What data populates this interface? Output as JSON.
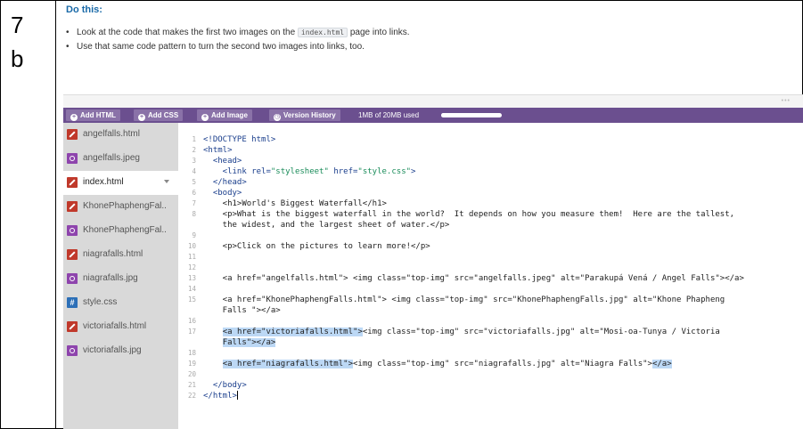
{
  "step": {
    "number": "7",
    "letter": "b"
  },
  "instructions": {
    "heading": "Do this:",
    "bullet1_before": "Look at the code that makes the first two images on the ",
    "bullet1_code": "index.html",
    "bullet1_after": " page into links.",
    "bullet2": "Use that same code pattern to turn the second two images into links, too."
  },
  "toolbar": {
    "add_html": "Add HTML",
    "add_css": "Add CSS",
    "add_image": "Add Image",
    "version_history": "Version History",
    "storage": "1MB of 20MB used",
    "storage_fraction": 0.05
  },
  "files": [
    {
      "name": "angelfalls.html",
      "type": "html"
    },
    {
      "name": "angelfalls.jpeg",
      "type": "img"
    },
    {
      "name": "index.html",
      "type": "html",
      "selected": true
    },
    {
      "name": "KhonePhaphengFal..",
      "type": "html"
    },
    {
      "name": "KhonePhaphengFal..",
      "type": "img"
    },
    {
      "name": "niagrafalls.html",
      "type": "html"
    },
    {
      "name": "niagrafalls.jpg",
      "type": "img"
    },
    {
      "name": "style.css",
      "type": "css",
      "icon_glyph": "#"
    },
    {
      "name": "victoriafalls.html",
      "type": "html"
    },
    {
      "name": "victoriafalls.jpg",
      "type": "img"
    }
  ],
  "code": {
    "line_numbers": [
      "1",
      "2",
      "3",
      "4",
      "5",
      "6",
      "7",
      "8",
      "9",
      "10",
      "11",
      "12",
      "13",
      "14",
      "15",
      "16",
      "17",
      "18",
      "19",
      "20",
      "21",
      "22"
    ],
    "l1": "<!DOCTYPE html>",
    "l2": "<html>",
    "l3": "  <head>",
    "l4a": "    <link ",
    "l4b": "rel=",
    "l4c": "\"stylesheet\"",
    "l4d": " href=",
    "l4e": "\"style.css\"",
    "l4f": ">",
    "l5": "  </head>",
    "l6": "  <body>",
    "l7": "    <h1>World's Biggest Waterfall</h1>",
    "l8": "    <p>What is the biggest waterfall in the world?  It depends on how you measure them!  Here are the tallest,",
    "l8b": "    the widest, and the largest sheet of water.</p>",
    "l10": "    <p>Click on the pictures to learn more!</p>",
    "l13": "    <a href=\"angelfalls.html\"> <img class=\"top-img\" src=\"angelfalls.jpeg\" alt=\"Parakupá Vená / Angel Falls\"></a>",
    "l15": "    <a href=\"KhonePhaphengFalls.html\"> <img class=\"top-img\" src=\"KhonePhaphengFalls.jpg\" alt=\"Khone Phapheng",
    "l15b": "    Falls \"></a>",
    "l17a": "<a href=\"victoriafalls.html\">",
    "l17b": "<img class=\"top-img\" src=\"victoriafalls.jpg\" alt=\"Mosi-oa-Tunya / Victoria",
    "l17c": "Falls\">",
    "l17d": "</a>",
    "l19a": "<a href=\"niagrafalls.html\">",
    "l19b": "<img class=\"top-img\" src=\"niagrafalls.jpg\" alt=\"Niagra Falls\">",
    "l19c": "</a>",
    "l21": "  </body>",
    "l22": "</html>"
  }
}
